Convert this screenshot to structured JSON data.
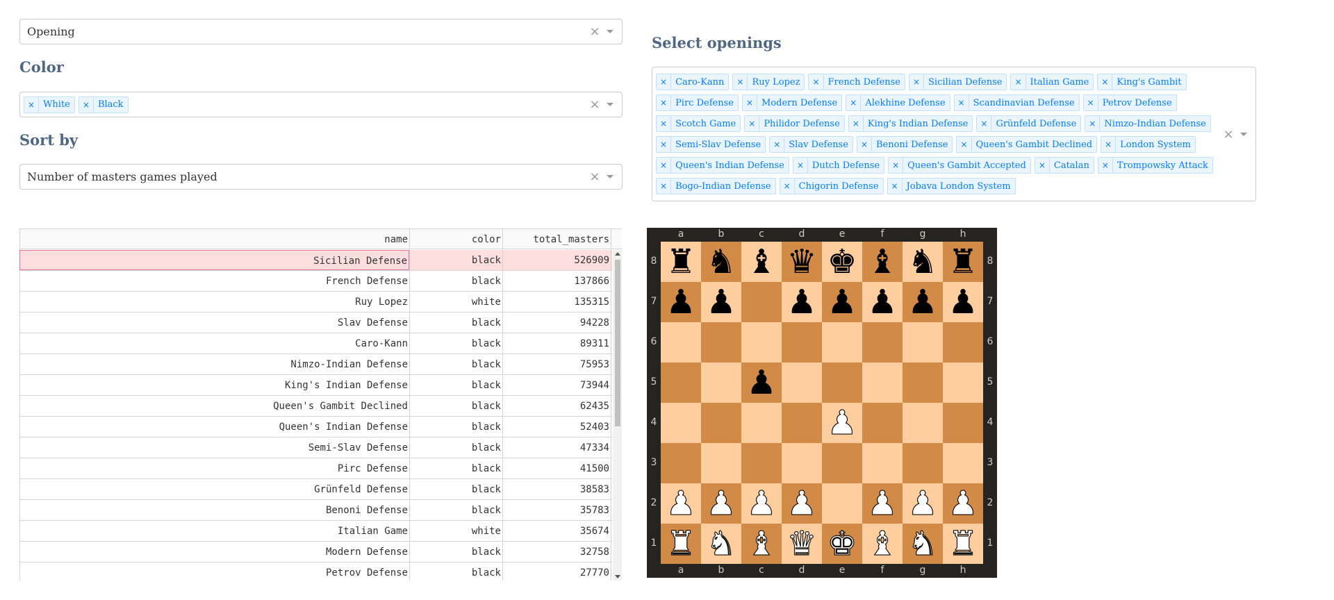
{
  "opening_dropdown": {
    "value": "Opening"
  },
  "color_section": {
    "title": "Color",
    "tags": [
      "White",
      "Black"
    ]
  },
  "sort_section": {
    "title": "Sort by",
    "value": "Number of masters games played"
  },
  "openings_section": {
    "title": "Select openings",
    "tags": [
      "Caro-Kann",
      "Ruy Lopez",
      "French Defense",
      "Sicilian Defense",
      "Italian Game",
      "King's Gambit",
      "Pirc Defense",
      "Modern Defense",
      "Alekhine Defense",
      "Scandinavian Defense",
      "Petrov Defense",
      "Scotch Game",
      "Philidor Defense",
      "King's Indian Defense",
      "Grünfeld Defense",
      "Nimzo-Indian Defense",
      "Semi-Slav Defense",
      "Slav Defense",
      "Benoni Defense",
      "Queen's Gambit Declined",
      "London System",
      "Queen's Indian Defense",
      "Dutch Defense",
      "Queen's Gambit Accepted",
      "Catalan",
      "Trompowsky Attack",
      "Bogo-Indian Defense",
      "Chigorin Defense",
      "Jobava London System"
    ]
  },
  "table": {
    "columns": [
      "name",
      "color",
      "total_masters"
    ],
    "rows": [
      [
        "Sicilian Defense",
        "black",
        "526909"
      ],
      [
        "French Defense",
        "black",
        "137866"
      ],
      [
        "Ruy Lopez",
        "white",
        "135315"
      ],
      [
        "Slav Defense",
        "black",
        "94228"
      ],
      [
        "Caro-Kann",
        "black",
        "89311"
      ],
      [
        "Nimzo-Indian Defense",
        "black",
        "75953"
      ],
      [
        "King's Indian Defense",
        "black",
        "73944"
      ],
      [
        "Queen's Gambit Declined",
        "black",
        "62435"
      ],
      [
        "Queen's Indian Defense",
        "black",
        "52403"
      ],
      [
        "Semi-Slav Defense",
        "black",
        "47334"
      ],
      [
        "Pirc Defense",
        "black",
        "41500"
      ],
      [
        "Grünfeld Defense",
        "black",
        "38583"
      ],
      [
        "Benoni Defense",
        "black",
        "35783"
      ],
      [
        "Italian Game",
        "white",
        "35674"
      ],
      [
        "Modern Defense",
        "black",
        "32758"
      ],
      [
        "Petrov Defense",
        "black",
        "27770"
      ]
    ],
    "active_row": 0
  },
  "board": {
    "files": [
      "a",
      "b",
      "c",
      "d",
      "e",
      "f",
      "g",
      "h"
    ],
    "ranks": [
      "8",
      "7",
      "6",
      "5",
      "4",
      "3",
      "2",
      "1"
    ],
    "position": [
      [
        "r",
        "n",
        "b",
        "q",
        "k",
        "b",
        "n",
        "r"
      ],
      [
        "p",
        "p",
        "",
        "p",
        "p",
        "p",
        "p",
        "p"
      ],
      [
        "",
        "",
        "",
        "",
        "",
        "",
        "",
        ""
      ],
      [
        "",
        "",
        "p",
        "",
        "",
        "",
        "",
        ""
      ],
      [
        "",
        "",
        "",
        "",
        "P",
        "",
        "",
        ""
      ],
      [
        "",
        "",
        "",
        "",
        "",
        "",
        "",
        ""
      ],
      [
        "P",
        "P",
        "P",
        "P",
        "",
        "P",
        "P",
        "P"
      ],
      [
        "R",
        "N",
        "B",
        "Q",
        "K",
        "B",
        "N",
        "R"
      ]
    ],
    "light_color": "#ffce9e",
    "dark_color": "#d18b47"
  }
}
